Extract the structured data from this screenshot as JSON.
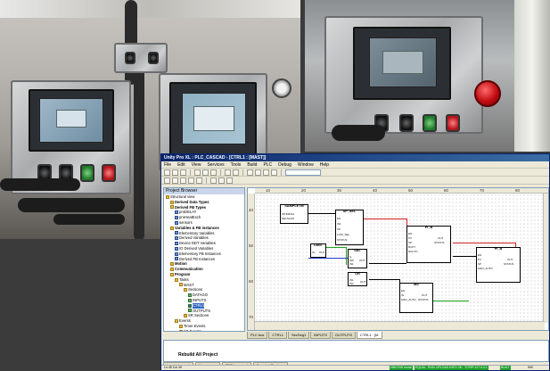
{
  "window": {
    "title": "Unity Pro XL : PLC_CASCAD - [CTRL1 : [MAST]]",
    "menu": [
      "File",
      "Edit",
      "View",
      "Services",
      "Tools",
      "Build",
      "PLC",
      "Debug",
      "Window",
      "Help"
    ]
  },
  "browser": {
    "header": "Project Browser",
    "items": [
      {
        "label": "Structural view",
        "level": 0,
        "icon": "folder-icon",
        "style": "normal"
      },
      {
        "label": "Derived Data Types",
        "level": 1,
        "icon": "folder-icon",
        "style": "bold"
      },
      {
        "label": "Derived FB Types",
        "level": 1,
        "icon": "folder-icon",
        "style": "bold"
      },
      {
        "label": "proDELAY",
        "level": 2,
        "icon": "fb-icon",
        "style": "normal"
      },
      {
        "label": "proHeatExch",
        "level": 2,
        "icon": "fb-icon",
        "style": "normal"
      },
      {
        "label": "sensors",
        "level": 2,
        "icon": "fb-icon",
        "style": "normal"
      },
      {
        "label": "Variables & FB instances",
        "level": 1,
        "icon": "folder-icon",
        "style": "bold"
      },
      {
        "label": "Elementary Variables",
        "level": 2,
        "icon": "var-icon",
        "style": "normal"
      },
      {
        "label": "Derived Variables",
        "level": 2,
        "icon": "var-icon",
        "style": "normal"
      },
      {
        "label": "Device DDT Variables",
        "level": 2,
        "icon": "var-icon",
        "style": "normal"
      },
      {
        "label": "IO Derived Variables",
        "level": 2,
        "icon": "var-icon",
        "style": "normal"
      },
      {
        "label": "Elementary FB Instances",
        "level": 2,
        "icon": "var-icon",
        "style": "normal"
      },
      {
        "label": "Derived FB Instances",
        "level": 2,
        "icon": "var-icon",
        "style": "normal"
      },
      {
        "label": "Motion",
        "level": 1,
        "icon": "folder-icon",
        "style": "bold"
      },
      {
        "label": "Communication",
        "level": 1,
        "icon": "folder-icon",
        "style": "bold"
      },
      {
        "label": "Program",
        "level": 1,
        "icon": "folder-icon",
        "style": "bold"
      },
      {
        "label": "Tasks",
        "level": 2,
        "icon": "folder-icon",
        "style": "normal"
      },
      {
        "label": "MAST",
        "level": 3,
        "icon": "folder-icon",
        "style": "normal"
      },
      {
        "label": "Sections",
        "level": 4,
        "icon": "folder-icon",
        "style": "normal"
      },
      {
        "label": "DATAGO",
        "level": 5,
        "icon": "section-icon",
        "style": "normal"
      },
      {
        "label": "INPUTS",
        "level": 5,
        "icon": "section-icon",
        "style": "normal"
      },
      {
        "label": "CTRL1",
        "level": 5,
        "icon": "section-icon",
        "style": "selected"
      },
      {
        "label": "OUTPUTS",
        "level": 5,
        "icon": "section-icon",
        "style": "normal"
      },
      {
        "label": "SR Sections",
        "level": 4,
        "icon": "folder-icon",
        "style": "normal"
      },
      {
        "label": "Events",
        "level": 2,
        "icon": "folder-icon",
        "style": "normal"
      },
      {
        "label": "Timer Events",
        "level": 3,
        "icon": "folder-icon",
        "style": "normal"
      },
      {
        "label": "I/O Events",
        "level": 3,
        "icon": "folder-icon",
        "style": "normal"
      },
      {
        "label": "Animation Tables",
        "level": 1,
        "icon": "folder-icon",
        "style": "bold"
      },
      {
        "label": "Operator Screens",
        "level": 1,
        "icon": "folder-icon",
        "style": "bold"
      },
      {
        "label": "CTRL1",
        "level": 2,
        "icon": "screen-icon",
        "style": "normal"
      }
    ]
  },
  "editor": {
    "ruler_top": [
      "10",
      "20",
      "30",
      "40",
      "50",
      "60",
      "70",
      "80"
    ],
    "ruler_left": [
      "40",
      "50",
      "60",
      "70"
    ],
    "blocks": [
      {
        "id": "SAMPLETM",
        "title": "SAMPLETM",
        "pins": [
          "INTERVAL",
          "DELSCAN"
        ]
      },
      {
        "id": "SP_SEL",
        "title": "SP_SEL",
        "pins": [
          "EN",
          "IN1",
          "SP",
          "LOW_SEL",
          "STATUS"
        ]
      },
      {
        "id": "LIMIT",
        "title": "LIMIT",
        "pins": [
          "IN",
          "OUT"
        ]
      },
      {
        "id": "SEL",
        "title": "SEL",
        "pins": [
          "G",
          "IN0",
          "IN1",
          "OUT"
        ]
      },
      {
        "id": "OR",
        "title": "OR",
        "pins": [
          "IN1",
          "IN2",
          "OUT"
        ]
      },
      {
        "id": "PI_B1",
        "title": "PI_B",
        "pins": [
          "EN",
          "PV",
          "SP",
          "RCPY",
          "RAUTO",
          "OUT",
          "STATUS"
        ]
      },
      {
        "id": "MS",
        "title": "MS",
        "pins": [
          "EN",
          "IN",
          "MAN_AUTO",
          "OUT",
          "STATUS"
        ]
      },
      {
        "id": "PI_B2",
        "title": "PI_B",
        "pins": [
          "EN",
          "PV",
          "SP",
          "MAN_AUTO",
          "OUT",
          "STATUS"
        ]
      }
    ]
  },
  "doc_tabs": [
    "PLC bus",
    "CTRL1",
    "SecSeg1",
    "INPUTS",
    "OUTPUTS",
    "CTRL1 : [M"
  ],
  "output": {
    "rebuild_label": "Rebuild All Project"
  },
  "output_tabs": [
    "Import / export",
    "User errors",
    "FDT log event",
    "Search / Replace"
  ],
  "status": {
    "left": "Ln 45 Col 49",
    "right": [
      "HMI R/W mode",
      "EQUAL",
      "RUN",
      "UPLOAD INFO OK",
      "TCPIP:127.0.0.1",
      "BUILT",
      "INS"
    ]
  },
  "colors": {
    "titlebar": "#0a246a",
    "status_green": "#1e9e2c",
    "estop_red": "#c10c12",
    "screen_blue": "#6f8ea3"
  }
}
